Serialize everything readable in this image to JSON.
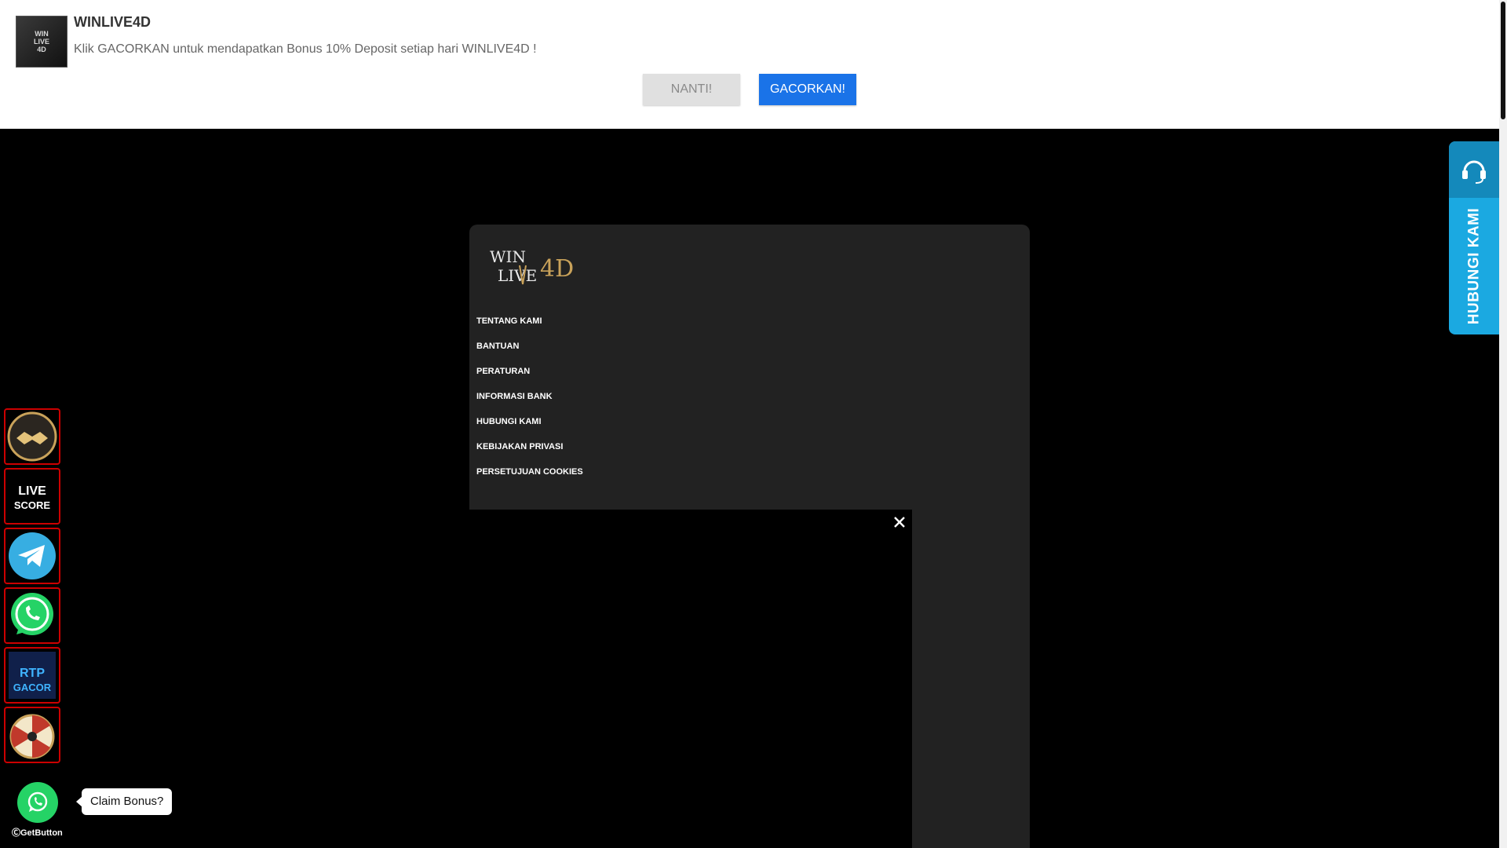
{
  "notification": {
    "icon_text_line1": "WIN",
    "icon_text_line2": "LIVE",
    "icon_text_line3": "4D",
    "title": "WINLIVE4D",
    "body": "Klik GACORKAN untuk mendapatkan Bonus 10% Deposit setiap hari WINLIVE4D !",
    "later_label": "NANTI!",
    "allow_label": "GACORKAN!"
  },
  "footer": {
    "logo_line1": "WIN",
    "logo_line2": "LIVE",
    "logo_line3": "4D",
    "links": [
      "TENTANG KAMI",
      "BANTUAN",
      "PERATURAN",
      "INFORMASI BANK",
      "HUBUNGI KAMI",
      "KEBIJAKAN PRIVASI",
      "PERSETUJUAN COOKIES"
    ]
  },
  "sidebar_icons": [
    {
      "name": "partnership-handshake-icon",
      "text": ""
    },
    {
      "name": "live-score-icon",
      "text1": "LIVE",
      "text2": "SCORE"
    },
    {
      "name": "telegram-icon"
    },
    {
      "name": "whatsapp-icon"
    },
    {
      "name": "rtp-gacor-icon",
      "text1": "RTP",
      "text2": "GACOR"
    },
    {
      "name": "lucky-wheel-icon"
    }
  ],
  "contact_tab": {
    "label": "HUBUNGI KAMI"
  },
  "getbutton": {
    "bubble": "Claim Bonus?",
    "credit": "GetButton"
  },
  "colors": {
    "primary_button": "#1a73e8",
    "contact_tab": "#1ba9e1",
    "sidebar_border": "#cc0000",
    "whatsapp": "#25d366",
    "panel": "#222222"
  }
}
